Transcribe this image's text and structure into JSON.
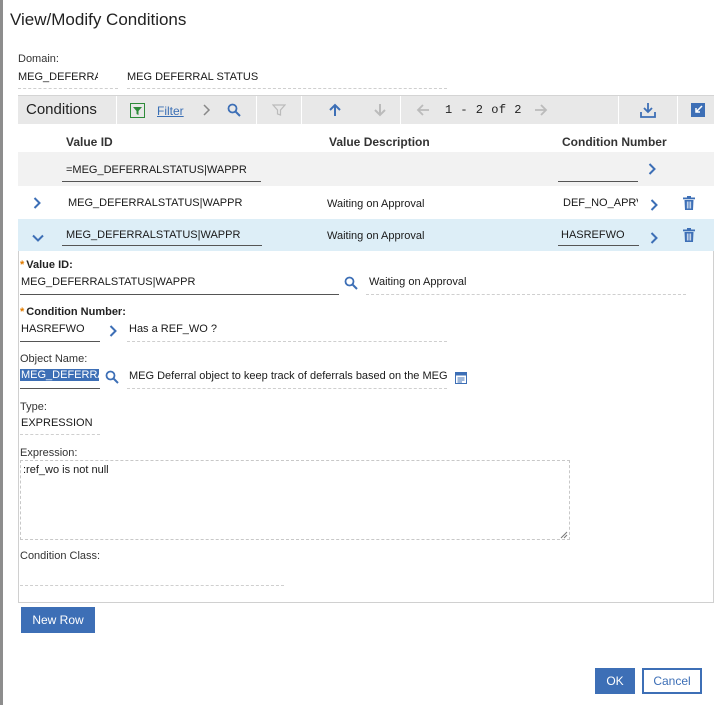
{
  "dialog": {
    "title": "View/Modify Conditions"
  },
  "domain": {
    "label": "Domain:",
    "value": "MEG_DEFERRAL",
    "description": "MEG DEFERRAL STATUS"
  },
  "toolbar": {
    "title": "Conditions",
    "filter_label": "Filter",
    "pager": "1 - 2 of 2"
  },
  "table": {
    "columns": [
      "Value ID",
      "Value Description",
      "Condition Number"
    ],
    "filter": {
      "value_id": "=MEG_DEFERRALSTATUS|WAPPR",
      "condition_number": ""
    },
    "rows": [
      {
        "value_id": "MEG_DEFERRALSTATUS|WAPPR",
        "description": "Waiting on Approval",
        "condition_number": "DEF_NO_APRVL",
        "expanded": false
      },
      {
        "value_id": "MEG_DEFERRALSTATUS|WAPPR",
        "description": "Waiting on Approval",
        "condition_number": "HASREFWO",
        "expanded": true
      }
    ]
  },
  "details": {
    "value_id": {
      "label": "Value ID:",
      "value": "MEG_DEFERRALSTATUS|WAPPR",
      "description": "Waiting on Approval"
    },
    "condition_number": {
      "label": "Condition Number:",
      "value": "HASREFWO",
      "description": "Has a REF_WO ?"
    },
    "object_name": {
      "label": "Object Name:",
      "value": "MEG_DEFERRAL",
      "description": "MEG Deferral object to keep track of deferrals based on the MEG"
    },
    "type": {
      "label": "Type:",
      "value": "EXPRESSION"
    },
    "expression": {
      "label": "Expression:",
      "value": ":ref_wo is not null"
    },
    "condition_class": {
      "label": "Condition Class:",
      "value": ""
    }
  },
  "buttons": {
    "new_row": "New Row",
    "ok": "OK",
    "cancel": "Cancel"
  },
  "colors": {
    "accent": "#3d6fb6",
    "required": "#e07b00",
    "selected_row": "#ddeef7"
  }
}
